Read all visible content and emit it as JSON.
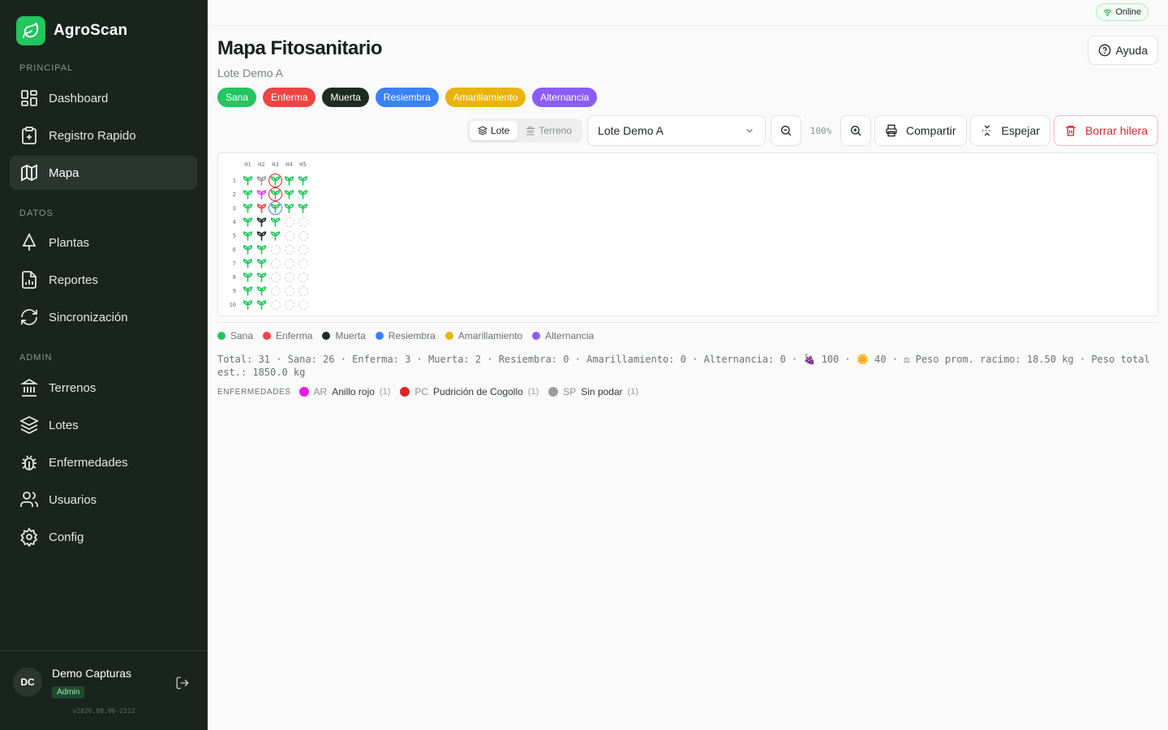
{
  "app": {
    "name": "AgroScan",
    "version": "v2026.08.06-2112"
  },
  "sidebar": {
    "sections": [
      {
        "label": "PRINCIPAL",
        "items": [
          {
            "label": "Dashboard",
            "icon": "dashboard-icon"
          },
          {
            "label": "Registro Rapido",
            "icon": "clipboard-plus-icon"
          },
          {
            "label": "Mapa",
            "icon": "map-icon",
            "active": true
          }
        ]
      },
      {
        "label": "DATOS",
        "items": [
          {
            "label": "Plantas",
            "icon": "tree-icon"
          },
          {
            "label": "Reportes",
            "icon": "report-icon"
          },
          {
            "label": "Sincronización",
            "icon": "refresh-icon"
          }
        ]
      },
      {
        "label": "ADMIN",
        "items": [
          {
            "label": "Terrenos",
            "icon": "landmark-icon"
          },
          {
            "label": "Lotes",
            "icon": "layers-icon"
          },
          {
            "label": "Enfermedades",
            "icon": "bug-icon"
          },
          {
            "label": "Usuarios",
            "icon": "users-icon"
          },
          {
            "label": "Config",
            "icon": "gear-icon"
          }
        ]
      }
    ]
  },
  "user": {
    "initials": "DC",
    "name": "Demo Capturas",
    "role": "Admin"
  },
  "topbar": {
    "status": "Online"
  },
  "header": {
    "title": "Mapa Fitosanitario",
    "subtitle": "Lote Demo A",
    "help_label": "Ayuda"
  },
  "status_chips": [
    {
      "label": "Sana",
      "color": "#22c55e"
    },
    {
      "label": "Enferma",
      "color": "#ef4444"
    },
    {
      "label": "Muerta",
      "color": "#1f2a24"
    },
    {
      "label": "Resiembra",
      "color": "#3b82f6"
    },
    {
      "label": "Amarillamiento",
      "color": "#eab308"
    },
    {
      "label": "Alternancia",
      "color": "#8b5cf6"
    }
  ],
  "toolbar": {
    "view_lote": "Lote",
    "view_terreno": "Terreno",
    "selected_lote": "Lote Demo A",
    "zoom": "100%",
    "share_label": "Compartir",
    "mirror_label": "Espejar",
    "delete_row_label": "Borrar hilera"
  },
  "map": {
    "columns": [
      "H1",
      "H2",
      "H3",
      "H4",
      "H5"
    ],
    "rows": [
      "1",
      "2",
      "3",
      "4",
      "5",
      "6",
      "7",
      "8",
      "9",
      "10"
    ],
    "cells": [
      [
        "sana",
        "sana-gray",
        "sana-ring-red",
        "sana",
        "sana"
      ],
      [
        "sana",
        "magenta",
        "sana-ring-red",
        "sana",
        "sana"
      ],
      [
        "sana",
        "enferma",
        "sana-ring-blue",
        "sana",
        "sana"
      ],
      [
        "sana",
        "muerta",
        "sana",
        "empty",
        "empty"
      ],
      [
        "sana",
        "muerta",
        "sana",
        "empty",
        "empty"
      ],
      [
        "sana",
        "sana",
        "empty",
        "empty",
        "empty"
      ],
      [
        "sana",
        "sana",
        "empty",
        "empty",
        "empty"
      ],
      [
        "sana",
        "sana",
        "empty",
        "empty",
        "empty"
      ],
      [
        "sana",
        "sana",
        "empty",
        "empty",
        "empty"
      ],
      [
        "sana",
        "sana",
        "empty",
        "empty",
        "empty"
      ]
    ],
    "cell_colors": {
      "sana": "#22c55e",
      "sana-gray": "#9aa19c",
      "magenta": "#d946ef",
      "enferma": "#ef4444",
      "muerta": "#1f2a24",
      "ring-red": "#dc2626",
      "ring-blue": "#3b82f6"
    }
  },
  "legend": [
    {
      "label": "Sana",
      "color": "#22c55e"
    },
    {
      "label": "Enferma",
      "color": "#ef4444"
    },
    {
      "label": "Muerta",
      "color": "#1f2a24"
    },
    {
      "label": "Resiembra",
      "color": "#3b82f6"
    },
    {
      "label": "Amarillamiento",
      "color": "#eab308"
    },
    {
      "label": "Alternancia",
      "color": "#8b5cf6"
    }
  ],
  "stats": {
    "text": "Total: 31 · Sana: 26 · Enferma: 3 · Muerta: 2 · Resiembra: 0 · Amarillamiento: 0 · Alternancia: 0 · 🍇 100 · 🌼 40 · ⚖ Peso prom. racimo: 18.50 kg · Peso total est.: 1850.0 kg"
  },
  "diseases": {
    "label": "ENFERMEDADES",
    "items": [
      {
        "code": "AR",
        "name": "Anillo rojo",
        "count": "(1)",
        "color": "#e11ee8"
      },
      {
        "code": "PC",
        "name": "Pudrición de Cogollo",
        "count": "(1)",
        "color": "#dc2626"
      },
      {
        "code": "SP",
        "name": "Sin podar",
        "count": "(1)",
        "color": "#9aa19c"
      }
    ]
  }
}
